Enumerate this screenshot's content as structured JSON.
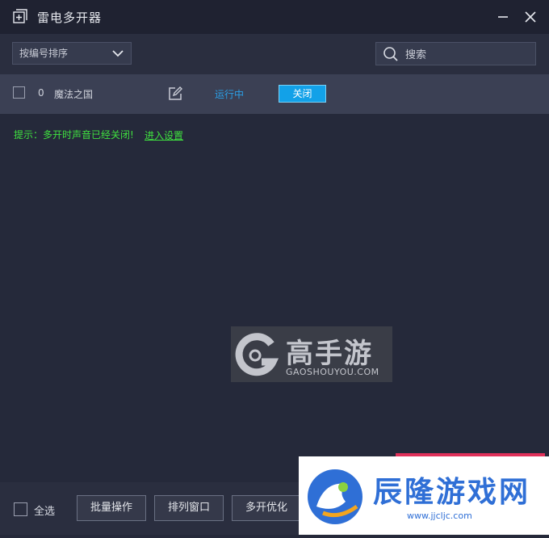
{
  "window": {
    "title": "雷电多开器",
    "icons": {
      "app": "add-window-icon",
      "minimize": "minimize-icon",
      "close": "close-icon"
    }
  },
  "toolbar": {
    "sort_value": "按编号排序",
    "search_placeholder": "搜索"
  },
  "instances": [
    {
      "index": "0",
      "name": "魔法之国",
      "status": "运行中",
      "action_label": "关闭",
      "checked": false
    }
  ],
  "hint": {
    "text": "提示：多开时声音已经关闭!",
    "link": "进入设置"
  },
  "watermark": {
    "title": "高手游",
    "subtitle": "GAOSHOUYOU.COM"
  },
  "footer": {
    "select_all_label": "全选",
    "buttons": [
      "批量操作",
      "排列窗口",
      "多开优化"
    ]
  },
  "overlay": {
    "title": "辰隆游戏网",
    "url": "www.jjcljc.com"
  },
  "colors": {
    "status_running": "#2b9fe6",
    "hint_green": "#3fe03f",
    "primary_button": "#12a1e8"
  }
}
